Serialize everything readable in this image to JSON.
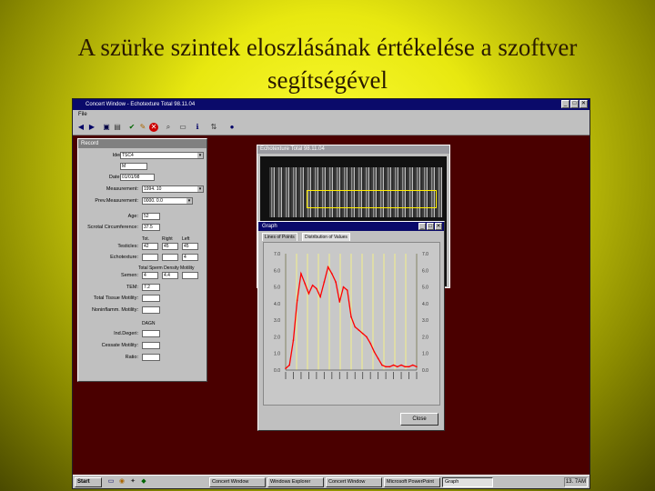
{
  "slide": {
    "title": "A szürke szintek eloszlásának értékelése a szoftver segítségével"
  },
  "window": {
    "title": "Concert Window - Echotexture Total 98.11.04",
    "menu": "File",
    "controls": [
      "_",
      "□",
      "✕"
    ]
  },
  "toolbar_icons": [
    "arrow-left-icon",
    "arrow-right-icon",
    "save-icon",
    "print-icon",
    "check-icon",
    "edit-icon",
    "delete-icon",
    "search-icon",
    "camera-icon",
    "info-icon"
  ],
  "record": {
    "title": "Record",
    "fields": [
      {
        "label": "Ident.Code:",
        "value": "TSC4",
        "dropdown": true
      },
      {
        "label": "Breed:",
        "value": "M"
      },
      {
        "label": "Date of Birth:",
        "value": "01/01/98"
      },
      {
        "label": "Measurement:",
        "value": "1994. 10",
        "dropdown": true
      },
      {
        "label": "Prev.Measurement:",
        "value": "0000. 0.0",
        "dropdown": true
      },
      {
        "label": "Age:",
        "value": "52"
      },
      {
        "label": "Scrotal Circumference:",
        "value": "37.5"
      }
    ],
    "col_heads": [
      "Tot.",
      "Right",
      "Left"
    ],
    "testicles_label": "Testicles:",
    "testicles_values": [
      "42",
      "45",
      "45"
    ],
    "echotexture_label": "Echotexture:",
    "echotexture_value": "4",
    "semen_heads": [
      "Total Sperm Density",
      "Motility"
    ],
    "semen_label": "Semen:",
    "semen_values": [
      "4",
      "4.4"
    ],
    "extra_fields": [
      {
        "label": "TEM:",
        "value": "7.2"
      },
      {
        "label": "Total Tissue Motility:",
        "value": ""
      },
      {
        "label": "Noninflamm. Motility:",
        "value": ""
      }
    ],
    "dna_head": "DAGN",
    "dna_fields": [
      {
        "label": "Ind.Degeri:",
        "value": ""
      },
      {
        "label": "Cessate Motility:",
        "value": ""
      },
      {
        "label": "Ratio:",
        "value": ""
      }
    ]
  },
  "echo": {
    "title": "Echotexture Total 98.11.04"
  },
  "graph": {
    "title": "Graph",
    "tabs": [
      "Lines of Points",
      "Distribution of Values"
    ],
    "close_label": "Close",
    "controls": [
      "_",
      "□",
      "✕"
    ]
  },
  "chart_data": {
    "type": "line",
    "title": "",
    "xlabel": "",
    "ylabel": "",
    "ylim": [
      0,
      7
    ],
    "yticks": [
      0,
      1,
      2,
      3,
      4,
      5,
      6,
      7
    ],
    "ytick_labels": [
      "0.0",
      "1.0",
      "2.0",
      "3.0",
      "4.0",
      "5.0",
      "6.0",
      "7.0"
    ],
    "grid": true,
    "gridline_color": "#f4f08a",
    "series": [
      {
        "color": "#ff0000",
        "values": [
          0.1,
          0.3,
          1.8,
          4.2,
          5.8,
          5.2,
          4.6,
          5.1,
          4.9,
          4.4,
          5.3,
          6.2,
          5.8,
          5.3,
          4.1,
          5.0,
          4.8,
          3.2,
          2.6,
          2.4,
          2.2,
          2.0,
          1.6,
          1.1,
          0.7,
          0.3,
          0.2,
          0.2,
          0.3,
          0.2,
          0.3,
          0.2,
          0.2,
          0.3,
          0.2
        ]
      }
    ]
  },
  "taskbar": {
    "start": "Start",
    "tasks": [
      "Concert Window",
      "Windows Explorer",
      "Concert Window",
      "Microsoft PowerPoint",
      "Graph"
    ],
    "clock": "13. 7AM",
    "quick_icons": [
      "desktop-icon",
      "explorer-icon",
      "tools-icon",
      "speaker-icon"
    ]
  }
}
